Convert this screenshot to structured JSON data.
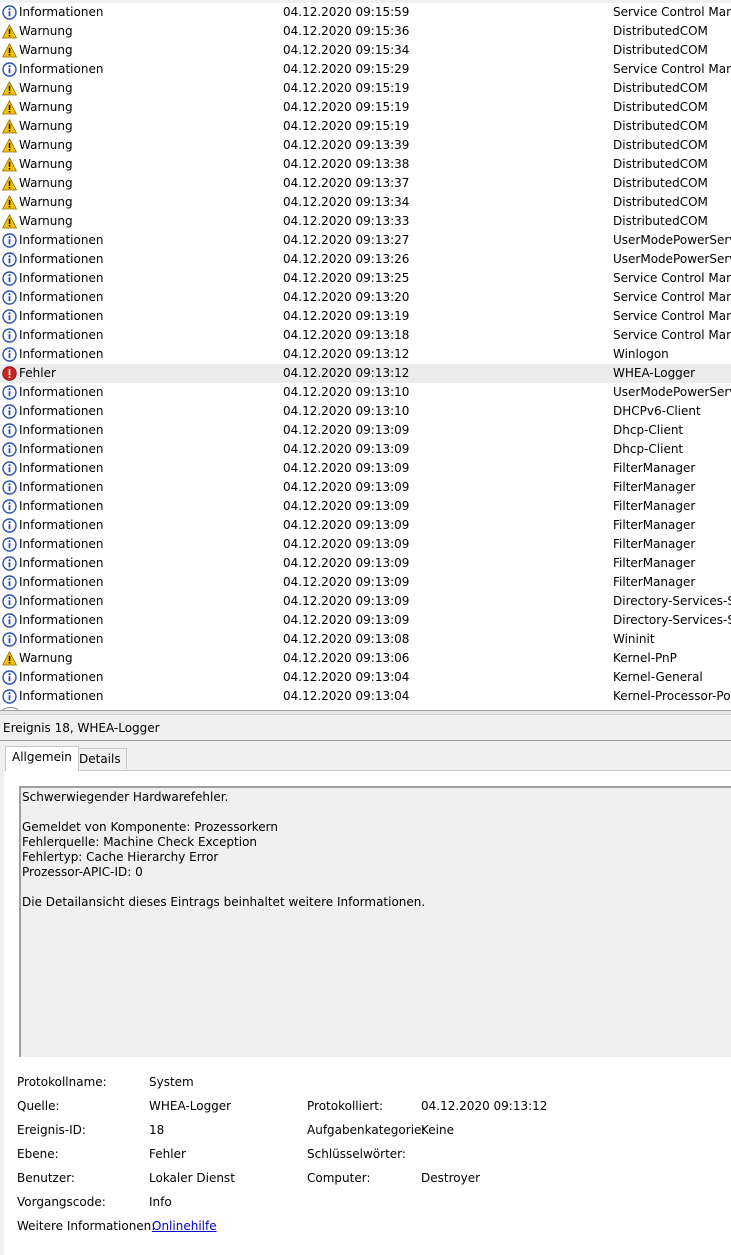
{
  "events": [
    {
      "level": "Informationen",
      "icon": "info-icon",
      "date": "04.12.2020 09:15:59",
      "source": "Service Control Manag"
    },
    {
      "level": "Warnung",
      "icon": "warning-icon",
      "date": "04.12.2020 09:15:36",
      "source": "DistributedCOM"
    },
    {
      "level": "Warnung",
      "icon": "warning-icon",
      "date": "04.12.2020 09:15:34",
      "source": "DistributedCOM"
    },
    {
      "level": "Informationen",
      "icon": "info-icon",
      "date": "04.12.2020 09:15:29",
      "source": "Service Control Manag"
    },
    {
      "level": "Warnung",
      "icon": "warning-icon",
      "date": "04.12.2020 09:15:19",
      "source": "DistributedCOM"
    },
    {
      "level": "Warnung",
      "icon": "warning-icon",
      "date": "04.12.2020 09:15:19",
      "source": "DistributedCOM"
    },
    {
      "level": "Warnung",
      "icon": "warning-icon",
      "date": "04.12.2020 09:15:19",
      "source": "DistributedCOM"
    },
    {
      "level": "Warnung",
      "icon": "warning-icon",
      "date": "04.12.2020 09:13:39",
      "source": "DistributedCOM"
    },
    {
      "level": "Warnung",
      "icon": "warning-icon",
      "date": "04.12.2020 09:13:38",
      "source": "DistributedCOM"
    },
    {
      "level": "Warnung",
      "icon": "warning-icon",
      "date": "04.12.2020 09:13:37",
      "source": "DistributedCOM"
    },
    {
      "level": "Warnung",
      "icon": "warning-icon",
      "date": "04.12.2020 09:13:34",
      "source": "DistributedCOM"
    },
    {
      "level": "Warnung",
      "icon": "warning-icon",
      "date": "04.12.2020 09:13:33",
      "source": "DistributedCOM"
    },
    {
      "level": "Informationen",
      "icon": "info-icon",
      "date": "04.12.2020 09:13:27",
      "source": "UserModePowerServic"
    },
    {
      "level": "Informationen",
      "icon": "info-icon",
      "date": "04.12.2020 09:13:26",
      "source": "UserModePowerServic"
    },
    {
      "level": "Informationen",
      "icon": "info-icon",
      "date": "04.12.2020 09:13:25",
      "source": "Service Control Manag"
    },
    {
      "level": "Informationen",
      "icon": "info-icon",
      "date": "04.12.2020 09:13:20",
      "source": "Service Control Manag"
    },
    {
      "level": "Informationen",
      "icon": "info-icon",
      "date": "04.12.2020 09:13:19",
      "source": "Service Control Manag"
    },
    {
      "level": "Informationen",
      "icon": "info-icon",
      "date": "04.12.2020 09:13:18",
      "source": "Service Control Manag"
    },
    {
      "level": "Informationen",
      "icon": "info-icon",
      "date": "04.12.2020 09:13:12",
      "source": "Winlogon"
    },
    {
      "level": "Fehler",
      "icon": "error-icon",
      "date": "04.12.2020 09:13:12",
      "source": "WHEA-Logger",
      "selected": true
    },
    {
      "level": "Informationen",
      "icon": "info-icon",
      "date": "04.12.2020 09:13:10",
      "source": "UserModePowerServic"
    },
    {
      "level": "Informationen",
      "icon": "info-icon",
      "date": "04.12.2020 09:13:10",
      "source": "DHCPv6-Client"
    },
    {
      "level": "Informationen",
      "icon": "info-icon",
      "date": "04.12.2020 09:13:09",
      "source": "Dhcp-Client"
    },
    {
      "level": "Informationen",
      "icon": "info-icon",
      "date": "04.12.2020 09:13:09",
      "source": "Dhcp-Client"
    },
    {
      "level": "Informationen",
      "icon": "info-icon",
      "date": "04.12.2020 09:13:09",
      "source": "FilterManager"
    },
    {
      "level": "Informationen",
      "icon": "info-icon",
      "date": "04.12.2020 09:13:09",
      "source": "FilterManager"
    },
    {
      "level": "Informationen",
      "icon": "info-icon",
      "date": "04.12.2020 09:13:09",
      "source": "FilterManager"
    },
    {
      "level": "Informationen",
      "icon": "info-icon",
      "date": "04.12.2020 09:13:09",
      "source": "FilterManager"
    },
    {
      "level": "Informationen",
      "icon": "info-icon",
      "date": "04.12.2020 09:13:09",
      "source": "FilterManager"
    },
    {
      "level": "Informationen",
      "icon": "info-icon",
      "date": "04.12.2020 09:13:09",
      "source": "FilterManager"
    },
    {
      "level": "Informationen",
      "icon": "info-icon",
      "date": "04.12.2020 09:13:09",
      "source": "FilterManager"
    },
    {
      "level": "Informationen",
      "icon": "info-icon",
      "date": "04.12.2020 09:13:09",
      "source": "Directory-Services-SAM"
    },
    {
      "level": "Informationen",
      "icon": "info-icon",
      "date": "04.12.2020 09:13:09",
      "source": "Directory-Services-SAM"
    },
    {
      "level": "Informationen",
      "icon": "info-icon",
      "date": "04.12.2020 09:13:08",
      "source": "Wininit"
    },
    {
      "level": "Warnung",
      "icon": "warning-icon",
      "date": "04.12.2020 09:13:06",
      "source": "Kernel-PnP"
    },
    {
      "level": "Informationen",
      "icon": "info-icon",
      "date": "04.12.2020 09:13:04",
      "source": "Kernel-General"
    },
    {
      "level": "Informationen",
      "icon": "info-icon",
      "date": "04.12.2020 09:13:04",
      "source": "Kernel-Processor-Pow"
    }
  ],
  "colors": {
    "info": "#2b4fa8",
    "warning": "#f4c20d",
    "error": "#c62828",
    "link": "#0000cc",
    "selected_row": "#ececec"
  },
  "detail": {
    "title": "Ereignis 18, WHEA-Logger",
    "tabs": [
      "Allgemein",
      "Details"
    ],
    "description": [
      "Schwerwiegender Hardwarefehler.",
      "",
      "Gemeldet von Komponente: Prozessorkern",
      "Fehlerquelle: Machine Check Exception",
      "Fehlertyp: Cache Hierarchy Error",
      "Prozessor-APIC-ID: 0",
      "",
      "Die Detailansicht dieses Eintrags beinhaltet weitere Informationen."
    ],
    "props": {
      "log_name_label": "Protokollname:",
      "log_name": "System",
      "source_label": "Quelle:",
      "source": "WHEA-Logger",
      "logged_label": "Protokolliert:",
      "logged": "04.12.2020 09:13:12",
      "event_id_label": "Ereignis-ID:",
      "event_id": "18",
      "task_category_label": "Aufgabenkategorie:",
      "task_category": "Keine",
      "level_label": "Ebene:",
      "level": "Fehler",
      "keywords_label": "Schlüsselwörter:",
      "keywords": "",
      "user_label": "Benutzer:",
      "user": "Lokaler Dienst",
      "computer_label": "Computer:",
      "computer": "Destroyer",
      "opcode_label": "Vorgangscode:",
      "opcode": "Info",
      "more_info_label": "Weitere Informationen:",
      "more_info_link": "Onlinehilfe"
    }
  }
}
